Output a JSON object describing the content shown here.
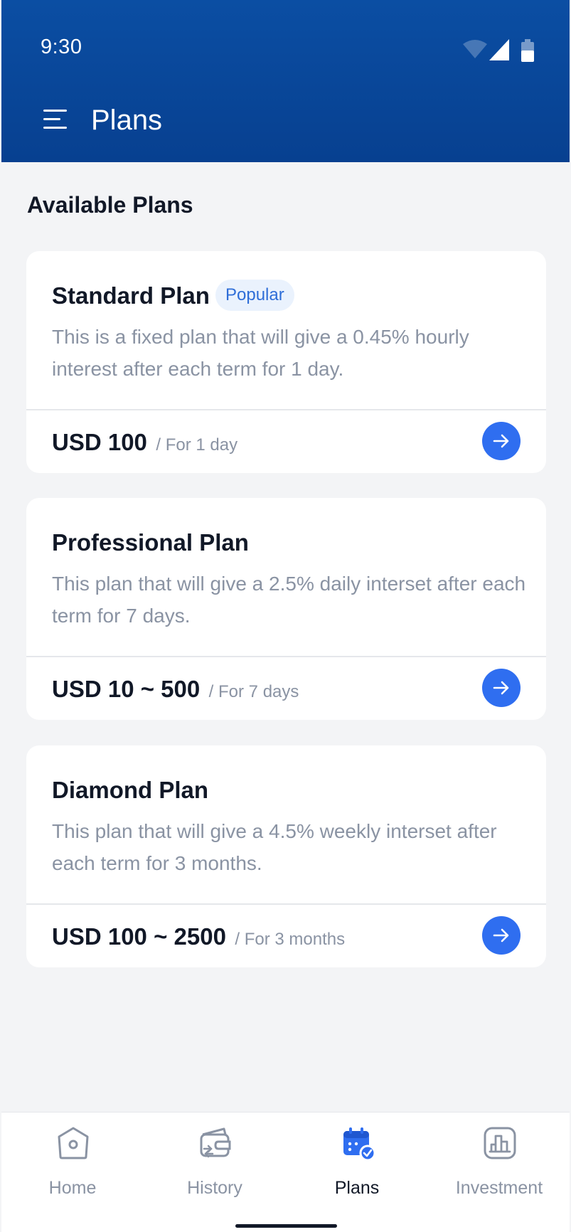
{
  "status_bar": {
    "time": "9:30"
  },
  "header": {
    "title": "Plans",
    "menu_icon": "hamburger-menu-icon"
  },
  "section_title": "Available Plans",
  "plans": [
    {
      "name": "Standard Plan",
      "badge": "Popular",
      "description": "This is a fixed plan that will give a 0.45% hourly interest after each term for 1 day.",
      "price": "USD 100",
      "term": "/ For 1 day"
    },
    {
      "name": "Professional Plan",
      "description": "This plan that will give a 2.5% daily interset after each term for 7 days.",
      "price": "USD 10 ~ 500",
      "term": "/ For 7 days"
    },
    {
      "name": "Diamond Plan",
      "description": "This plan that will give a 4.5% weekly interset after each term for 3 months.",
      "price": "USD 100 ~ 2500",
      "term": "/ For 3 months"
    }
  ],
  "bottom_nav": {
    "items": [
      {
        "label": "Home",
        "icon": "home-icon"
      },
      {
        "label": "History",
        "icon": "history-wallet-icon"
      },
      {
        "label": "Plans",
        "icon": "calendar-check-icon",
        "active": true
      },
      {
        "label": "Investment",
        "icon": "bar-chart-icon"
      }
    ]
  },
  "colors": {
    "header": "#0b4ea3",
    "accent": "#2f6ef0",
    "badge_bg": "#eaf2fd",
    "badge_text": "#2f6ed8",
    "muted_text": "#8a93a3",
    "background": "#f3f4f6"
  }
}
